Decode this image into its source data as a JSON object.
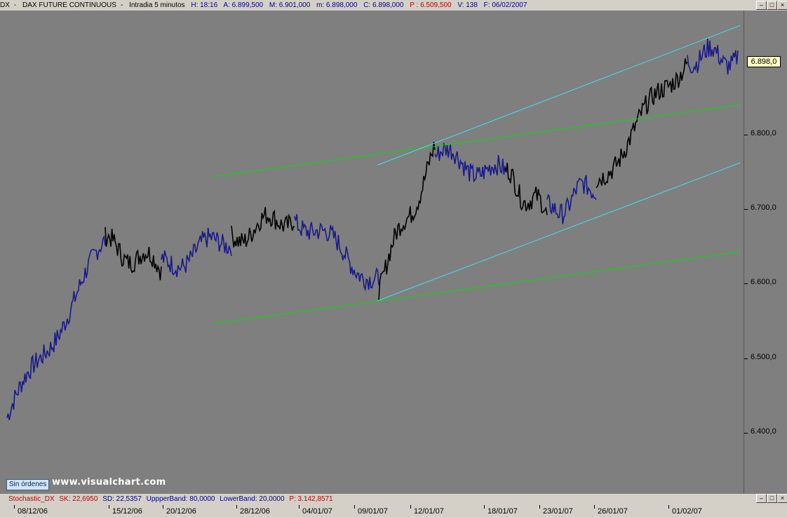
{
  "header": {
    "symbol": "DX",
    "name": "DAX FUTURE CONTINUOUS",
    "interval": "Intradia 5 minutos",
    "h": "H: 18:16",
    "a": "A: 6.899,500",
    "m": "M: 6.901,000",
    "mm": "m: 6.898,000",
    "c": "C: 6.898,000",
    "p": "P : 6.509,500",
    "v": "V: 138",
    "f": "F: 06/02/2007"
  },
  "window_buttons": [
    "–",
    "□",
    "×"
  ],
  "price_axis": [
    "6.800,0",
    "6.700,0",
    "6.600,0",
    "6.500,0",
    "6.400,0"
  ],
  "last_price": "6.898,0",
  "orders_label": "Sin órdenes",
  "watermark": "www.visualchart.com",
  "stochastic": {
    "name": "Stochastic_DX",
    "sk": "SK: 22,6950",
    "sd": "SD: 22,5357",
    "upper": "UppperBand: 80,0000",
    "lower": "LowerBand: 20,0000",
    "p": "P: 3.142,8571"
  },
  "date_axis": [
    "08/12/06",
    "15/12/06",
    "20/12/06",
    "28/12/06",
    "04/01/07",
    "09/01/07",
    "12/01/07",
    "18/01/07",
    "23/01/07",
    "26/01/07",
    "01/02/07"
  ],
  "colors": {
    "background": "#7f7f7f",
    "bull": "#000000",
    "bear": "#1a1a8c",
    "trend_green": "#00e000",
    "trend_cyan": "#40e0f0"
  },
  "chart_data": {
    "type": "line",
    "title": "DAX FUTURE CONTINUOUS",
    "ylim": [
      6320,
      6960
    ],
    "x": [
      "08/12/06",
      "15/12/06",
      "20/12/06",
      "28/12/06",
      "04/01/07",
      "09/01/07",
      "12/01/07",
      "18/01/07",
      "23/01/07",
      "26/01/07",
      "01/02/07",
      "06/02/07"
    ],
    "series": [
      {
        "values": [
          6420,
          6650,
          6620,
          6660,
          6690,
          6600,
          6770,
          6740,
          6690,
          6730,
          6900,
          6898
        ]
      }
    ]
  }
}
